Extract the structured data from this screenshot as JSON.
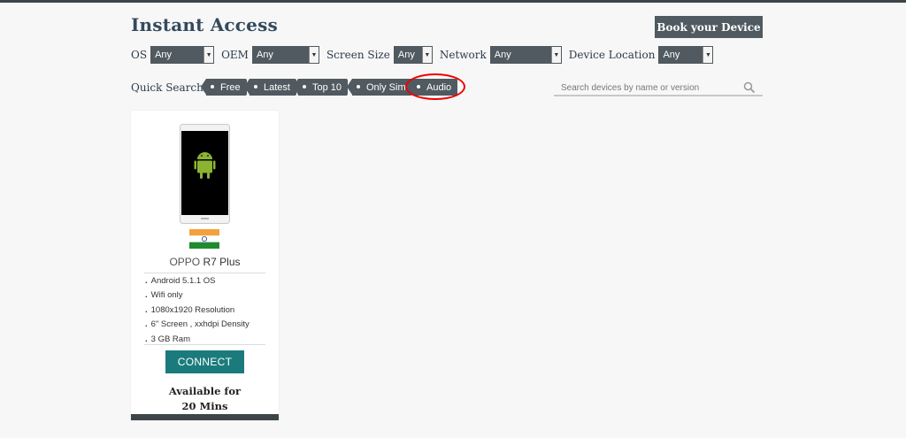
{
  "header": {
    "title": "Instant Access",
    "book_button": "Book your Device"
  },
  "filters": [
    {
      "label": "OS",
      "value": "Any"
    },
    {
      "label": "OEM",
      "value": "Any"
    },
    {
      "label": "Screen Size",
      "value": "Any"
    },
    {
      "label": "Network",
      "value": "Any"
    },
    {
      "label": "Device Location",
      "value": "Any"
    }
  ],
  "quick_search": {
    "label": "Quick Search",
    "tags": [
      "Free",
      "Latest",
      "Top 10",
      "Only Sim",
      "Audio"
    ],
    "highlighted_tag": "Audio"
  },
  "search": {
    "placeholder": "Search devices by name or version",
    "icon": "search-icon"
  },
  "device": {
    "brand": "OPPO",
    "model": "R7 Plus",
    "flag": "india-flag",
    "specs": [
      "Android 5.1.1 OS",
      "Wifi only",
      "1080x1920 Resolution",
      "6\" Screen , xxhdpi Density",
      "3 GB Ram"
    ],
    "connect_label": "CONNECT",
    "availability_line1": "Available for",
    "availability_line2": "20 Mins"
  },
  "colors": {
    "dark_slate": "#505a60",
    "connect_teal": "#1b7b7c",
    "highlight_red": "#e00000",
    "title_navy": "#344a5e"
  }
}
